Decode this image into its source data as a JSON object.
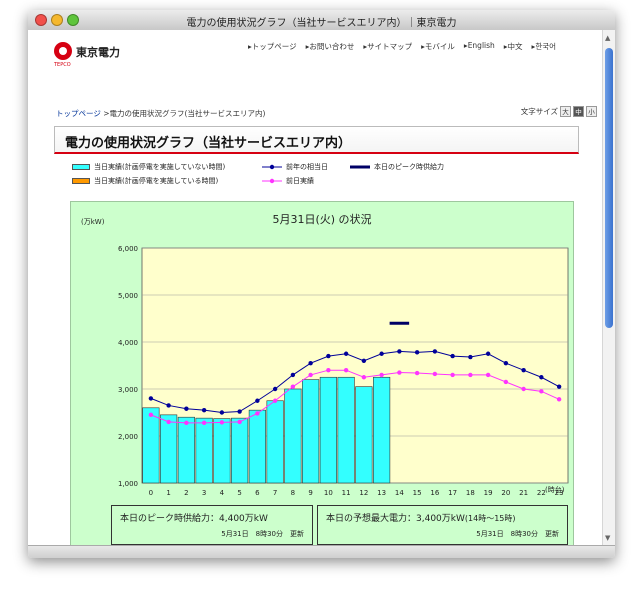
{
  "window": {
    "title": "電力の使用状況グラフ（当社サービスエリア内）｜東京電力"
  },
  "header": {
    "logo_text": "東京電力",
    "logo_sub": "TEPCO",
    "nav": [
      "トップページ",
      "お問い合わせ",
      "サイトマップ",
      "モバイル",
      "English",
      "中文",
      "한국어"
    ]
  },
  "breadcrumb": {
    "home": "トップページ",
    "separator": ">",
    "current": "電力の使用状況グラフ(当社サービスエリア内)"
  },
  "text_size": {
    "label": "文字サイズ",
    "options": [
      "大",
      "中",
      "小"
    ],
    "selected": "中"
  },
  "page_title": "電力の使用状況グラフ（当社サービスエリア内）",
  "legend": {
    "actual_no_outage": "当日実績(計画停電を実施していない時間)",
    "actual_outage": "当日実績(計画停電を実施している時間)",
    "last_year": "前年の相当日",
    "prev_day": "前日実績",
    "peak_supply": "本日のピーク時供給力"
  },
  "chart_data": {
    "type": "bar",
    "title": "5月31日(火) の状況",
    "ylabel": "(万kW)",
    "xlabel": "(時台)",
    "ylim": [
      1000,
      6000
    ],
    "yticks": [
      "1,000",
      "2,000",
      "3,000",
      "4,000",
      "5,000",
      "6,000"
    ],
    "ytick_values": [
      1000,
      2000,
      3000,
      4000,
      5000,
      6000
    ],
    "categories": [
      "0",
      "1",
      "2",
      "3",
      "4",
      "5",
      "6",
      "7",
      "8",
      "9",
      "10",
      "11",
      "12",
      "13",
      "14",
      "15",
      "16",
      "17",
      "18",
      "19",
      "20",
      "21",
      "22",
      "23"
    ],
    "series": [
      {
        "name": "当日実績(計画停電を実施していない時間)",
        "type": "bar",
        "color": "#33ffff",
        "values": [
          2600,
          2450,
          2400,
          2380,
          2370,
          2380,
          2550,
          2750,
          3000,
          3200,
          3250,
          3250,
          3050,
          3250,
          null,
          null,
          null,
          null,
          null,
          null,
          null,
          null,
          null,
          null
        ]
      },
      {
        "name": "前年の相当日",
        "type": "line",
        "color": "#000099",
        "values": [
          2800,
          2650,
          2580,
          2550,
          2500,
          2520,
          2750,
          3000,
          3300,
          3550,
          3700,
          3750,
          3600,
          3750,
          3800,
          3780,
          3800,
          3700,
          3680,
          3750,
          3550,
          3400,
          3250,
          3050
        ]
      },
      {
        "name": "前日実績",
        "type": "line",
        "color": "#ff33ff",
        "values": [
          2450,
          2300,
          2280,
          2280,
          2290,
          2300,
          2480,
          2750,
          3050,
          3300,
          3400,
          3400,
          3250,
          3300,
          3350,
          3340,
          3320,
          3300,
          3300,
          3300,
          3150,
          3000,
          2950,
          2780
        ]
      },
      {
        "name": "本日のピーク時供給力",
        "type": "marker",
        "color": "#000066",
        "x": "14",
        "value": 4400
      }
    ]
  },
  "peak_supply_box": {
    "label": "本日のピーク時供給力：4,400万kW",
    "date": "5月31日",
    "time": "8時30分",
    "update": "更新"
  },
  "forecast_box": {
    "label": "本日の予想最大電力：3,400万kW",
    "hours": "(14時～15時)",
    "date": "5月31日",
    "time": "8時30分",
    "update": "更新"
  }
}
